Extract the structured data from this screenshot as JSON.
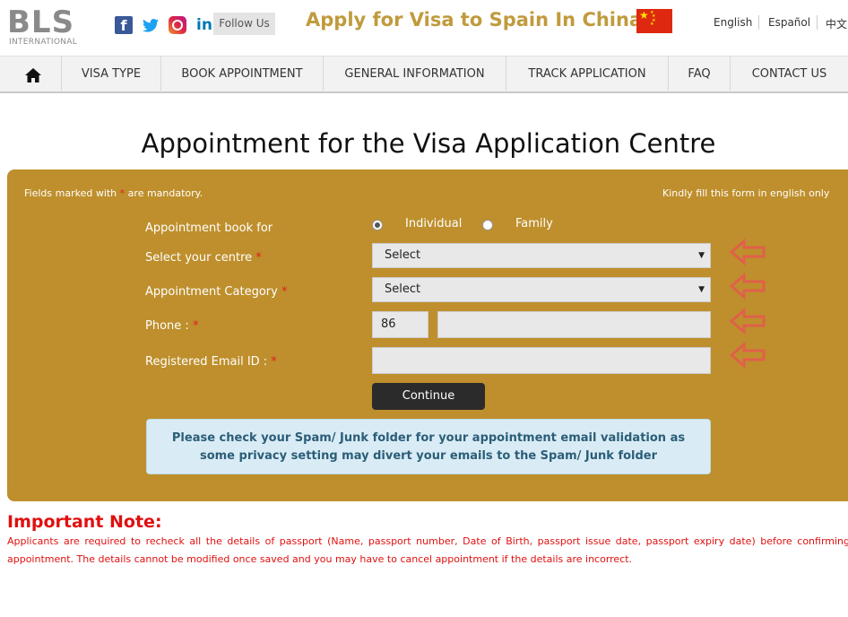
{
  "brand": {
    "logo_text": "BLS",
    "logo_sub": "INTERNATIONAL"
  },
  "header": {
    "social": [
      "facebook-icon",
      "twitter-icon",
      "instagram-icon",
      "linkedin-icon"
    ],
    "follow_label": "Follow Us",
    "title": "Apply for Visa to Spain In China",
    "flag": "china-flag",
    "languages": [
      "English",
      "Español",
      "中文"
    ]
  },
  "nav": {
    "items": [
      "VISA TYPE",
      "BOOK APPOINTMENT",
      "GENERAL INFORMATION",
      "TRACK APPLICATION",
      "FAQ",
      "CONTACT US"
    ]
  },
  "page_title": "Appointment for the Visa Application Centre",
  "form": {
    "mandatory_note_pre": "Fields marked with",
    "mandatory_star": "*",
    "mandatory_note_post": "are mandatory.",
    "english_note": "Kindly fill this form in english only",
    "book_for_label": "Appointment book for",
    "options": [
      "Individual",
      "Family"
    ],
    "selected_option": "Individual",
    "centre_label": "Select your centre",
    "centre_value": "Select",
    "category_label": "Appointment Category",
    "category_value": "Select",
    "phone_label": "Phone :",
    "phone_code": "86",
    "phone_value": "",
    "email_label": "Registered Email ID :",
    "email_value": "",
    "continue_label": "Continue",
    "info_line1": "Please check your Spam/ Junk folder for your appointment email validation as",
    "info_line2": "some privacy setting may divert your emails to the Spam/ Junk folder"
  },
  "important": {
    "title": "Important Note:",
    "text": "Applicants are required to recheck all the details of passport (Name, passport number, Date of Birth, passport issue date, passport expiry date) before confirming appointment. The details cannot be modified once saved and you may have to cancel appointment if the details are incorrect."
  },
  "colors": {
    "accent": "#c09b3d",
    "panel": "#be8f2c",
    "note": "#e01010",
    "info_bg": "#d9ecf5"
  }
}
